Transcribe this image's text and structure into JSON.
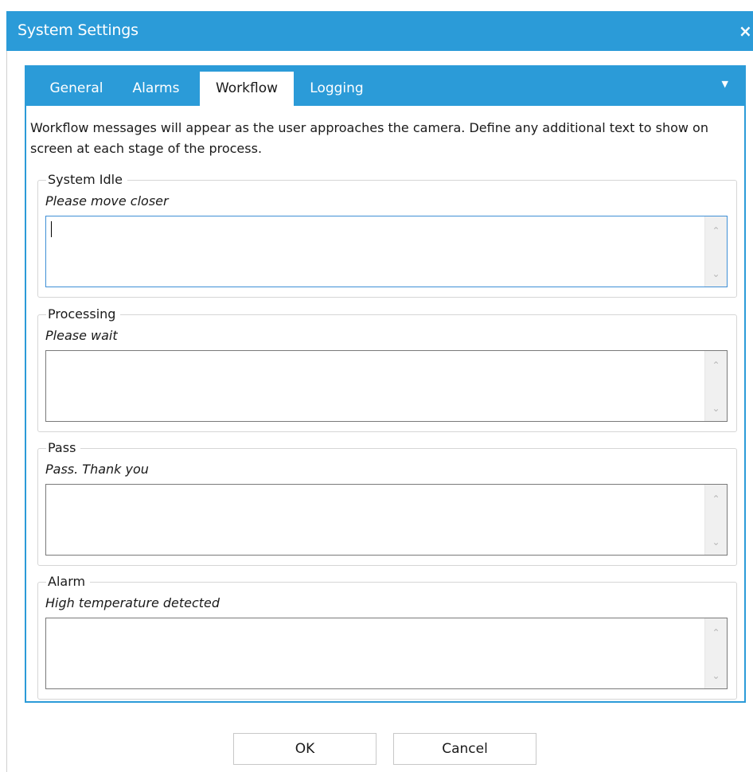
{
  "window": {
    "title": "System Settings",
    "close_symbol": "×"
  },
  "tabs": [
    {
      "label": "General",
      "active": false
    },
    {
      "label": "Alarms",
      "active": false
    },
    {
      "label": "Workflow",
      "active": true
    },
    {
      "label": "Logging",
      "active": false
    }
  ],
  "tab_menu_icon": "▼",
  "description": "Workflow messages will appear as the user approaches the camera. Define any additional text to show on screen at each stage of the process.",
  "stages": [
    {
      "title": "System Idle",
      "hint": "Please move closer",
      "value": ""
    },
    {
      "title": "Processing",
      "hint": "Please wait",
      "value": ""
    },
    {
      "title": "Pass",
      "hint": "Pass. Thank you",
      "value": ""
    },
    {
      "title": "Alarm",
      "hint": "High temperature detected",
      "value": ""
    }
  ],
  "scroll": {
    "up": "⌃",
    "down": "⌄"
  },
  "buttons": {
    "ok": "OK",
    "cancel": "Cancel"
  },
  "colors": {
    "accent": "#2b9bd8",
    "focus_border": "#3f8fd6"
  }
}
